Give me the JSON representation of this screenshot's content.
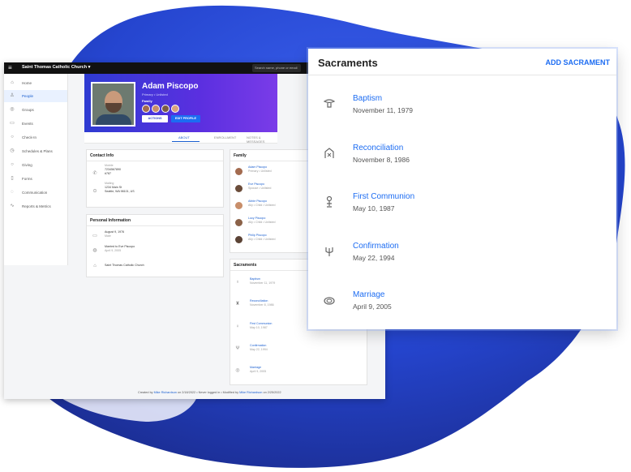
{
  "colors": {
    "accent": "#1c6cf2",
    "topbar": "#111111",
    "hero_start": "#2e3bd2",
    "hero_end": "#7a3ce8",
    "blob": "#2d4fe0"
  },
  "topbar": {
    "menu_icon": "hamburger-icon",
    "org": "Saint Thomas Catholic Church ▾",
    "search_placeholder": "Search name, phone or email"
  },
  "sidebar": {
    "items": [
      {
        "label": "Home",
        "icon": "home-icon"
      },
      {
        "label": "People",
        "icon": "people-icon",
        "active": true
      },
      {
        "label": "Groups",
        "icon": "groups-icon"
      },
      {
        "label": "Events",
        "icon": "calendar-icon"
      },
      {
        "label": "Check-In",
        "icon": "checkin-icon"
      },
      {
        "label": "Schedules & Plans",
        "icon": "schedule-icon"
      },
      {
        "label": "Giving",
        "icon": "giving-icon"
      },
      {
        "label": "Forms",
        "icon": "forms-icon"
      },
      {
        "label": "Communication",
        "icon": "communication-icon"
      },
      {
        "label": "Reports & Metrics",
        "icon": "reports-icon"
      }
    ]
  },
  "profile": {
    "name": "Adam Piscopo",
    "subtitle": "Primary • Unlisted",
    "family_label": "Family",
    "actions_label": "ACTIONS",
    "edit_label": "EDIT PROFILE"
  },
  "tabs": [
    "ABOUT",
    "ENROLLMENT",
    "NOTES & MESSAGES"
  ],
  "contact_info": {
    "title": "Contact Info",
    "mobile_label": "Mobile",
    "mobile_value": "7234567890",
    "mobile_ext": "#787",
    "mailing_label": "Mailing",
    "mailing_line1": "1234 Main St",
    "mailing_line2": "Seattle, WA 98101, US"
  },
  "personal_info": {
    "title": "Personal Information",
    "birth_date": "August 9, 1976",
    "birth_sub": "Male",
    "married": "Married to Eve Piscopo",
    "married_sub": "April 9, 2005",
    "church": "Saint Thomas Catholic Church"
  },
  "family": {
    "title": "Family",
    "members": [
      {
        "name": "Adam Piscopo",
        "role": "Primary • Unlisted"
      },
      {
        "name": "Eve Piscopo",
        "role": "Spouse • Unlisted"
      },
      {
        "name": "Abbie Piscopo",
        "role": "Ally • Child • Unlisted"
      },
      {
        "name": "Lucy Piscopo",
        "role": "Ally • Child • Unlisted"
      },
      {
        "name": "Philip Piscopo",
        "role": "Ally • Child • Unlisted"
      }
    ]
  },
  "sacraments": {
    "title": "Sacraments",
    "add_label": "ADD SACRAMENT",
    "items": [
      {
        "name": "Baptism",
        "date": "November 11, 1979",
        "icon": "baptism-font-icon"
      },
      {
        "name": "Reconciliation",
        "date": "November 8, 1986",
        "icon": "reconciliation-icon"
      },
      {
        "name": "First Communion",
        "date": "May 10, 1987",
        "icon": "chalice-icon"
      },
      {
        "name": "Confirmation",
        "date": "May 22, 1994",
        "icon": "confirmation-dove-icon"
      },
      {
        "name": "Marriage",
        "date": "April 9, 2005",
        "icon": "rings-icon"
      }
    ]
  },
  "footer": {
    "created_prefix": "Created by",
    "created_by": "Mike Richardson",
    "created_mid": "on 2/18/2022 • Never logged in • Modified by",
    "modified_by": "Mike Richardson",
    "modified_suffix": "on 2/25/2022"
  }
}
